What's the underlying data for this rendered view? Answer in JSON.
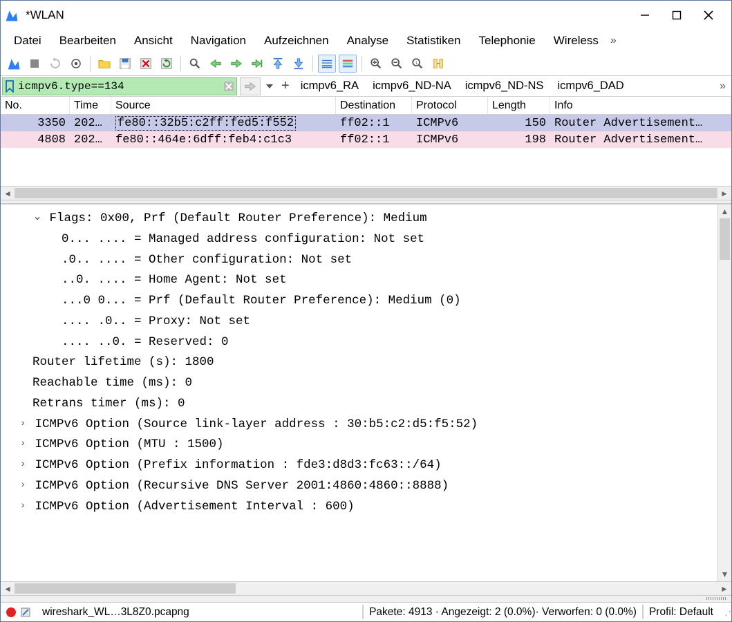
{
  "window": {
    "title": "*WLAN"
  },
  "menu": {
    "items": [
      "Datei",
      "Bearbeiten",
      "Ansicht",
      "Navigation",
      "Aufzeichnen",
      "Analyse",
      "Statistiken",
      "Telephonie",
      "Wireless"
    ]
  },
  "filter": {
    "value": "icmpv6.type==134",
    "bookmarks": [
      "icmpv6_RA",
      "icmpv6_ND-NA",
      "icmpv6_ND-NS",
      "icmpv6_DAD"
    ]
  },
  "packet_table": {
    "columns": [
      "No.",
      "Time",
      "Source",
      "Destination",
      "Protocol",
      "Length",
      "Info"
    ],
    "rows": [
      {
        "no": "3350",
        "time": "202…",
        "src": "fe80::32b5:c2ff:fed5:f552",
        "dst": "ff02::1",
        "proto": "ICMPv6",
        "len": "150",
        "info": "Router Advertisement…",
        "selected": true,
        "src_dotted": true
      },
      {
        "no": "4808",
        "time": "202…",
        "src": "fe80::464e:6dff:feb4:c1c3",
        "dst": "ff02::1",
        "proto": "ICMPv6",
        "len": "198",
        "info": "Router Advertisement…",
        "selected": false,
        "alt": true
      }
    ]
  },
  "detail": {
    "lines": [
      {
        "indent": 1,
        "chevron": "v",
        "text": "Flags: 0x00, Prf (Default Router Preference): Medium"
      },
      {
        "indent": 2,
        "text": "0... .... = Managed address configuration: Not set"
      },
      {
        "indent": 2,
        "text": ".0.. .... = Other configuration: Not set"
      },
      {
        "indent": 2,
        "text": "..0. .... = Home Agent: Not set"
      },
      {
        "indent": 2,
        "text": "...0 0... = Prf (Default Router Preference): Medium (0)"
      },
      {
        "indent": 2,
        "text": ".... .0.. = Proxy: Not set"
      },
      {
        "indent": 2,
        "text": ".... ..0. = Reserved: 0"
      },
      {
        "indent": 1,
        "text": "Router lifetime (s): 1800"
      },
      {
        "indent": 1,
        "text": "Reachable time (ms): 0"
      },
      {
        "indent": 1,
        "text": "Retrans timer (ms): 0"
      },
      {
        "indent": 0,
        "chevron": ">",
        "text": "ICMPv6 Option (Source link-layer address : 30:b5:c2:d5:f5:52)"
      },
      {
        "indent": 0,
        "chevron": ">",
        "text": "ICMPv6 Option (MTU : 1500)"
      },
      {
        "indent": 0,
        "chevron": ">",
        "text": "ICMPv6 Option (Prefix information : fde3:d8d3:fc63::/64)"
      },
      {
        "indent": 0,
        "chevron": ">",
        "text": "ICMPv6 Option (Recursive DNS Server 2001:4860:4860::8888)"
      },
      {
        "indent": 0,
        "chevron": ">",
        "text": "ICMPv6 Option (Advertisement Interval : 600)"
      }
    ]
  },
  "status": {
    "file": "wireshark_WL…3L8Z0.pcapng",
    "packets": "Pakete: 4913 · Angezeigt: 2 (0.0%)· Verworfen: 0 (0.0%)",
    "profile": "Profil: Default"
  }
}
